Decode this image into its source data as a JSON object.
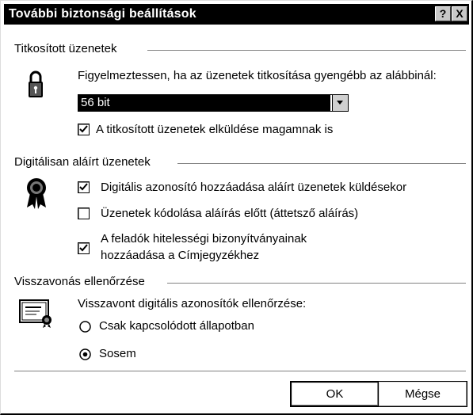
{
  "window": {
    "title": "További biztonsági beállítások",
    "help_label": "?",
    "close_label": "X"
  },
  "encrypted": {
    "group_label": "Titkosított üzenetek",
    "warn_label": "Figyelmeztessen, ha az üzenetek titkosítása gyengébb az alábbinál:",
    "strength_selected": "56 bit",
    "send_to_self_label": "A titkosított üzenetek elküldése magamnak is",
    "send_to_self_checked": true
  },
  "signed": {
    "group_label": "Digitálisan aláírt üzenetek",
    "add_id_label": "Digitális azonosító hozzáadása aláírt üzenetek küldésekor",
    "add_id_checked": true,
    "encode_label": "Üzenetek kódolása aláírás előtt (áttetsző aláírás)",
    "encode_checked": false,
    "add_senders_line1": "A feladók hitelességi bizonyítványainak",
    "add_senders_line2": "hozzáadása a Címjegyzékhez",
    "add_senders_checked": true
  },
  "revocation": {
    "group_label": "Visszavonás ellenőrzése",
    "check_label": "Visszavont digitális azonosítók ellenőrzése:",
    "option_online": "Csak kapcsolódott állapotban",
    "option_never": "Sosem",
    "selected": "never"
  },
  "buttons": {
    "ok": "OK",
    "cancel": "Mégse"
  }
}
